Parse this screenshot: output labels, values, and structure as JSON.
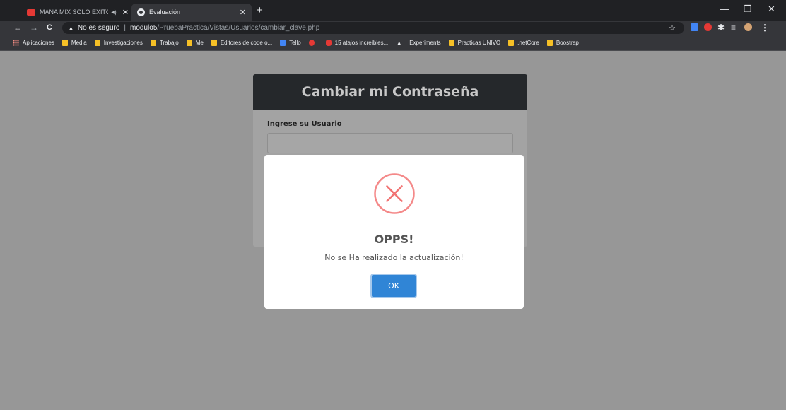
{
  "browser": {
    "tabs": [
      {
        "title": "MANA MIX SOLO EXITOS - Y",
        "icon": "youtube-icon",
        "audio": "◂)"
      },
      {
        "title": "Evaluación",
        "icon": "globe-icon"
      }
    ],
    "new_tab": "+",
    "window_controls": {
      "minimize": "—",
      "maximize": "❐",
      "close": "✕"
    },
    "nav": {
      "back": "←",
      "forward": "→",
      "reload": "C"
    },
    "address": {
      "warning_icon": "▲",
      "security_text": "No es seguro",
      "separator": "|",
      "host": "modulo5",
      "path": "/PruebaPractica/Vistas/Usuarios/cambiar_clave.php",
      "star": "☆"
    },
    "bookmarks": [
      {
        "label": "Aplicaciones",
        "icon": "apps-grid-icon"
      },
      {
        "label": "Media",
        "icon": "folder-icon"
      },
      {
        "label": "Investigaciones",
        "icon": "folder-icon"
      },
      {
        "label": "Trabajo",
        "icon": "folder-icon"
      },
      {
        "label": "Me",
        "icon": "folder-icon"
      },
      {
        "label": "Editores de code o...",
        "icon": "folder-icon"
      },
      {
        "label": "Tello",
        "icon": "trello-icon"
      },
      {
        "label": "",
        "icon": "gmail-icon"
      },
      {
        "label": "15 atajos increíbles...",
        "icon": "youtube-icon"
      },
      {
        "label": "Experiments",
        "icon": "flask-icon"
      },
      {
        "label": "Practicas UNIVO",
        "icon": "folder-icon"
      },
      {
        "label": ".netCore",
        "icon": "folder-icon"
      },
      {
        "label": "Boostrap",
        "icon": "folder-icon"
      }
    ]
  },
  "page": {
    "card_title": "Cambiar mi Contraseña",
    "username_label": "Ingrese su Usuario"
  },
  "modal": {
    "icon": "error-x-icon",
    "title": "OPPS!",
    "message": "No se Ha realizado la actualización!",
    "ok_label": "OK",
    "colors": {
      "error": "#f27474",
      "button": "#3085d6"
    }
  }
}
